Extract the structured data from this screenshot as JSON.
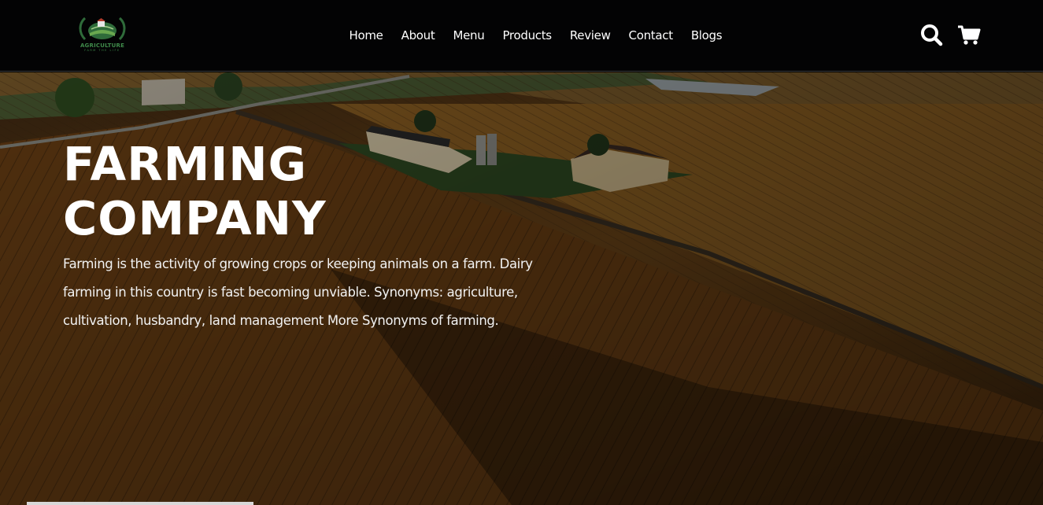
{
  "header": {
    "logo": {
      "name": "AGRICULTURE",
      "tagline": "FARM THE LIFE",
      "icon": "farm-wreath-logo",
      "color": "#3f8a4a"
    },
    "nav": [
      {
        "label": "Home"
      },
      {
        "label": "About"
      },
      {
        "label": "Menu"
      },
      {
        "label": "Products"
      },
      {
        "label": "Review"
      },
      {
        "label": "Contact"
      },
      {
        "label": "Blogs"
      }
    ],
    "icons": {
      "search": "search-icon",
      "cart": "shopping-cart-icon"
    }
  },
  "hero": {
    "title_line1": "FARMING",
    "title_line2": "COMPANY",
    "description": "Farming is the activity of growing crops or keeping animals on a farm. Dairy farming in this country is fast becoming unviable. Synonyms: agriculture, cultivation, husbandry, land management More Synonyms of farming.",
    "background": "aerial-farm-cornfield-image"
  }
}
